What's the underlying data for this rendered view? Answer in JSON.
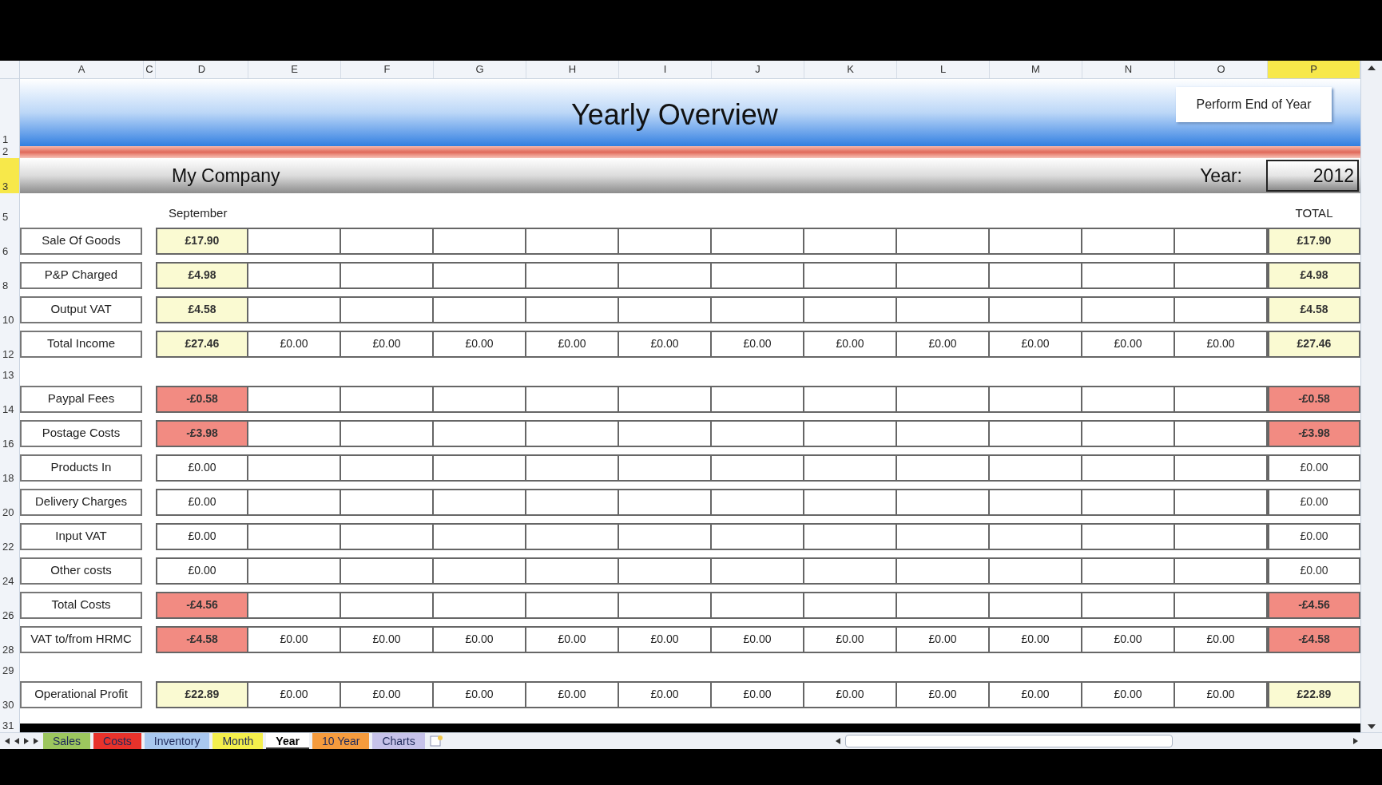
{
  "columns": [
    {
      "label": "A",
      "selected": false
    },
    {
      "label": "C",
      "selected": false
    },
    {
      "label": "D",
      "selected": false
    },
    {
      "label": "E",
      "selected": false
    },
    {
      "label": "F",
      "selected": false
    },
    {
      "label": "G",
      "selected": false
    },
    {
      "label": "H",
      "selected": false
    },
    {
      "label": "I",
      "selected": false
    },
    {
      "label": "J",
      "selected": false
    },
    {
      "label": "K",
      "selected": false
    },
    {
      "label": "L",
      "selected": false
    },
    {
      "label": "M",
      "selected": false
    },
    {
      "label": "N",
      "selected": false
    },
    {
      "label": "O",
      "selected": false
    },
    {
      "label": "P",
      "selected": true
    }
  ],
  "title": "Yearly Overview",
  "end_year_button": "Perform End of Year",
  "company": "My Company",
  "year_label": "Year:",
  "year_value": "2012",
  "month_header": "September",
  "total_header": "TOTAL",
  "rows": [
    {
      "kind": "banner",
      "number": "1",
      "selected": false
    },
    {
      "kind": "stripe",
      "number": "2",
      "selected": false
    },
    {
      "kind": "company",
      "number": "3",
      "selected": true
    },
    {
      "kind": "months",
      "number": "5",
      "selected": false
    },
    {
      "kind": "data",
      "number": "6",
      "selected": false,
      "label": "Sale Of Goods",
      "color": "#fafad2",
      "values": [
        "£17.90"
      ],
      "total": "£17.90"
    },
    {
      "kind": "data",
      "number": "8",
      "selected": false,
      "label": "P&P Charged",
      "color": "#fafad2",
      "values": [
        "£4.98"
      ],
      "total": "£4.98"
    },
    {
      "kind": "data",
      "number": "10",
      "selected": false,
      "label": "Output VAT",
      "color": "#fafad2",
      "values": [
        "£4.58"
      ],
      "total": "£4.58"
    },
    {
      "kind": "data",
      "number": "12",
      "selected": false,
      "label": "Total Income",
      "color": "#fafad2",
      "values": [
        "£27.46",
        "£0.00",
        "£0.00",
        "£0.00",
        "£0.00",
        "£0.00",
        "£0.00",
        "£0.00",
        "£0.00",
        "£0.00",
        "£0.00",
        "£0.00"
      ],
      "total": "£27.46"
    },
    {
      "kind": "spacer",
      "number": "13",
      "selected": false
    },
    {
      "kind": "data",
      "number": "14",
      "selected": false,
      "label": "Paypal Fees",
      "color": "#f28b82",
      "values": [
        "-£0.58"
      ],
      "total": "-£0.58"
    },
    {
      "kind": "data",
      "number": "16",
      "selected": false,
      "label": "Postage Costs",
      "color": "#f28b82",
      "values": [
        "-£3.98"
      ],
      "total": "-£3.98"
    },
    {
      "kind": "data",
      "number": "18",
      "selected": false,
      "label": "Products In",
      "color": "#ffffff",
      "values": [
        "£0.00"
      ],
      "total": "£0.00"
    },
    {
      "kind": "data",
      "number": "20",
      "selected": false,
      "label": "Delivery Charges",
      "color": "#ffffff",
      "values": [
        "£0.00"
      ],
      "total": "£0.00"
    },
    {
      "kind": "data",
      "number": "22",
      "selected": false,
      "label": "Input VAT",
      "color": "#ffffff",
      "values": [
        "£0.00"
      ],
      "total": "£0.00"
    },
    {
      "kind": "data",
      "number": "24",
      "selected": false,
      "label": "Other costs",
      "color": "#ffffff",
      "values": [
        "£0.00"
      ],
      "total": "£0.00"
    },
    {
      "kind": "data",
      "number": "26",
      "selected": false,
      "label": "Total Costs",
      "color": "#f28b82",
      "values": [
        "-£4.56"
      ],
      "total": "-£4.56"
    },
    {
      "kind": "data",
      "number": "28",
      "selected": false,
      "label": "VAT to/from HRMC",
      "color": "#f28b82",
      "values": [
        "-£4.58",
        "£0.00",
        "£0.00",
        "£0.00",
        "£0.00",
        "£0.00",
        "£0.00",
        "£0.00",
        "£0.00",
        "£0.00",
        "£0.00",
        "£0.00"
      ],
      "total": "-£4.58"
    },
    {
      "kind": "spacer",
      "number": "29",
      "selected": false
    },
    {
      "kind": "data",
      "number": "30",
      "selected": false,
      "label": "Operational Profit",
      "color": "#fafad2",
      "values": [
        "£22.89",
        "£0.00",
        "£0.00",
        "£0.00",
        "£0.00",
        "£0.00",
        "£0.00",
        "£0.00",
        "£0.00",
        "£0.00",
        "£0.00",
        "£0.00"
      ],
      "total": "£22.89"
    },
    {
      "kind": "spacer",
      "number": "31",
      "selected": false
    }
  ],
  "sheet_tabs": [
    {
      "label": "Sales",
      "color": "#9cc65e",
      "selected": false
    },
    {
      "label": "Costs",
      "color": "#e8322b",
      "selected": false
    },
    {
      "label": "Inventory",
      "color": "#a9c8ef",
      "selected": false
    },
    {
      "label": "Month",
      "color": "#f4ef4c",
      "selected": false
    },
    {
      "label": "Year",
      "color": "#ffffff",
      "selected": true
    },
    {
      "label": "10 Year",
      "color": "#f59b3d",
      "selected": false
    },
    {
      "label": "Charts",
      "color": "#c6c2e9",
      "selected": false
    }
  ]
}
